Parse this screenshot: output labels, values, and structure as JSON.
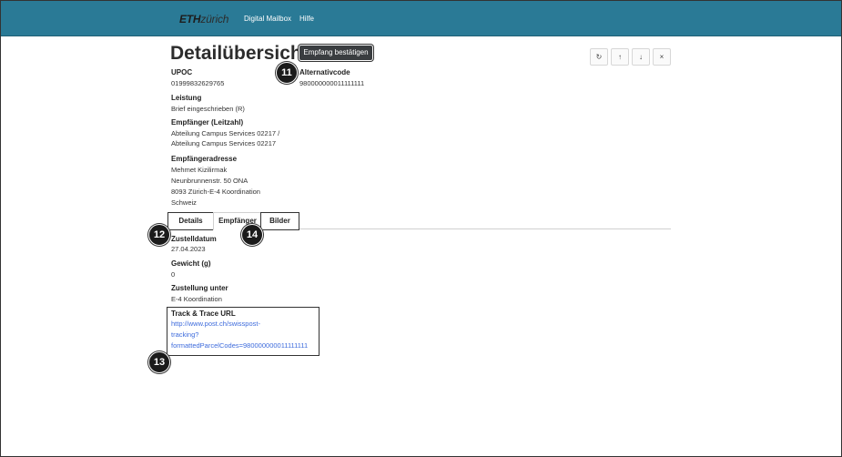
{
  "header": {
    "logo_bold": "ETH",
    "logo_light": "zürich",
    "nav": [
      "Digital Mailbox",
      "Hilfe"
    ]
  },
  "page": {
    "title": "Detailübersicht",
    "confirm_button": "Empfang bestätigen",
    "toolbar_icons": [
      "refresh-icon",
      "arrow-up-icon",
      "arrow-down-icon",
      "close-icon"
    ],
    "toolbar_glyphs": [
      "↻",
      "↑",
      "↓",
      "×"
    ]
  },
  "fields": {
    "upoc": {
      "label": "UPOC",
      "value": "01999832629765"
    },
    "alt_code": {
      "label": "Alternativcode",
      "value": "980000000011111111"
    },
    "leistung": {
      "label": "Leistung",
      "value": "Brief eingeschrieben (R)"
    },
    "empfaenger": {
      "label": "Empfänger (Leitzahl)",
      "line1": "Abteilung Campus Services 02217 /",
      "line2": "Abteilung Campus Services 02217"
    },
    "adresse": {
      "label": "Empfängeradresse",
      "line1": "Mehmet Kizilirmak",
      "line2": "Neunbrunnenstr. 50 ONA",
      "line3": "8093 Zürich-E-4 Koordination",
      "line4": "Schweiz"
    }
  },
  "tabs": [
    "Details",
    "Empfänger",
    "Bilder"
  ],
  "detail_fields": {
    "zustelldatum": {
      "label": "Zustelldatum",
      "value": "27.04.2023"
    },
    "gewicht": {
      "label": "Gewicht (g)",
      "value": "0"
    },
    "zustellung": {
      "label": "Zustellung unter",
      "value": "E-4 Koordination"
    },
    "track": {
      "label": "Track & Trace URL",
      "line1": "http://www.post.ch/swisspost-",
      "line2": "tracking?",
      "line3": "formattedParcelCodes=980000000011111111"
    }
  },
  "markers": [
    "11",
    "12",
    "13",
    "14"
  ]
}
